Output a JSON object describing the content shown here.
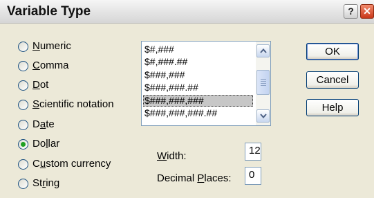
{
  "window": {
    "title": "Variable Type"
  },
  "title_buttons": {
    "help": "?",
    "close": "✕"
  },
  "types": [
    {
      "id": "numeric",
      "pre": "",
      "u": "N",
      "post": "umeric",
      "selected": false
    },
    {
      "id": "comma",
      "pre": "",
      "u": "C",
      "post": "omma",
      "selected": false
    },
    {
      "id": "dot",
      "pre": "",
      "u": "D",
      "post": "ot",
      "selected": false
    },
    {
      "id": "scientific",
      "pre": "",
      "u": "S",
      "post": "cientific notation",
      "selected": false
    },
    {
      "id": "date",
      "pre": "D",
      "u": "a",
      "post": "te",
      "selected": false
    },
    {
      "id": "dollar",
      "pre": "Do",
      "u": "l",
      "post": "lar",
      "selected": true
    },
    {
      "id": "custom",
      "pre": "C",
      "u": "u",
      "post": "stom currency",
      "selected": false
    },
    {
      "id": "string",
      "pre": "St",
      "u": "r",
      "post": "ing",
      "selected": false
    }
  ],
  "formats": {
    "items": [
      "$#,###",
      "$#,###.##",
      "$###,###",
      "$###,###.##",
      "$###,###,###",
      "$###,###,###.##"
    ],
    "selected_index": 4
  },
  "buttons": {
    "ok": "OK",
    "cancel": "Cancel",
    "help": "Help"
  },
  "width": {
    "pre": "",
    "u": "W",
    "post": "idth:",
    "value": "12"
  },
  "decimals": {
    "pre": "Decimal ",
    "u": "P",
    "post": "laces:",
    "value": "0"
  }
}
